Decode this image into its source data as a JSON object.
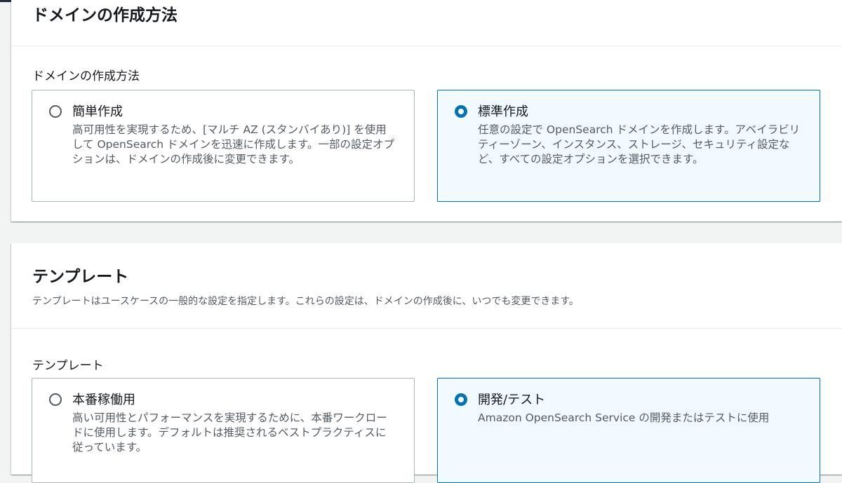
{
  "colors": {
    "accent": "#0073bb",
    "selected_bg": "#f1faff",
    "text_primary": "#16191f",
    "text_secondary": "#545b64",
    "border": "#aab7b8",
    "page_bg": "#f2f3f3"
  },
  "creation_section": {
    "title": "ドメインの作成方法",
    "field_label": "ドメインの作成方法",
    "options": [
      {
        "title": "簡単作成",
        "description": "高可用性を実現するため、[マルチ AZ (スタンバイあり)] を使用して OpenSearch ドメインを迅速に作成します。一部の設定オプションは、ドメインの作成後に変更できます。",
        "selected": false
      },
      {
        "title": "標準作成",
        "description": "任意の設定で OpenSearch ドメインを作成します。アベイラビリティーゾーン、インスタンス、ストレージ、セキュリティ設定など、すべての設定オプションを選択できます。",
        "selected": true
      }
    ]
  },
  "template_section": {
    "title": "テンプレート",
    "description": "テンプレートはユースケースの一般的な設定を指定します。これらの設定は、ドメインの作成後に、いつでも変更できます。",
    "field_label": "テンプレート",
    "options": [
      {
        "title": "本番稼働用",
        "description": "高い可用性とパフォーマンスを実現するために、本番ワークロードに使用します。デフォルトは推奨されるベストプラクティスに従っています。",
        "selected": false
      },
      {
        "title": "開発/テスト",
        "description": "Amazon OpenSearch Service の開発またはテストに使用",
        "selected": true
      }
    ]
  }
}
